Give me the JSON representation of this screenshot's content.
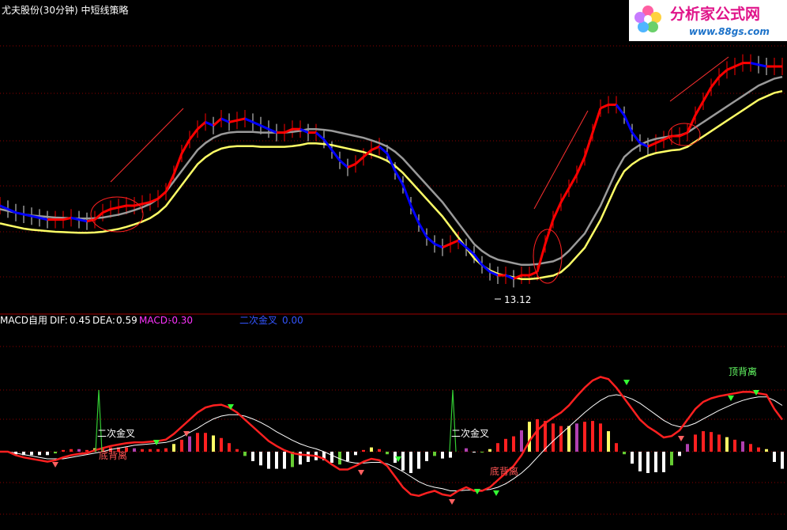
{
  "header": {
    "title": "尤夫股份(30分钟) 中短线策略"
  },
  "watermark": {
    "name": "分析家公式网",
    "url": "www.88gs.com"
  },
  "price_panel": {
    "low_label": "13.12"
  },
  "macd_panel": {
    "title": "MACD自用",
    "dif_label": "DIF:",
    "dif_value": "0.45",
    "dea_label": "DEA:",
    "dea_value": "0.59",
    "macd_label": "MACD:",
    "macd_value": "-0.30",
    "cross_label": "二次金叉",
    "cross_value": "0.00",
    "annotations": [
      "二次金叉",
      "底背离",
      "二次金叉",
      "底背离",
      "顶背离"
    ]
  },
  "colors": {
    "background": "#000000",
    "grid": "#8b0000",
    "up": "#ff0000",
    "down": "#0000ff",
    "ma_long": "#9a9a9a",
    "signal_line": "#ffff66",
    "macd_text": "#ff33ff",
    "cross_text": "#3355ff",
    "annotation": "#ffffff",
    "bottom_divergence": "#ff4444",
    "top_divergence": "#66ff66"
  },
  "chart_data": [
    {
      "type": "line",
      "name": "price",
      "x": [
        0,
        10,
        20,
        30,
        40,
        50,
        60,
        70,
        80,
        90,
        100,
        110,
        120,
        130,
        140,
        150,
        160,
        170,
        180,
        190,
        200,
        210,
        220,
        230,
        240,
        250,
        260,
        270,
        280,
        290,
        300,
        310,
        320,
        330,
        340,
        350,
        360,
        370,
        380,
        390,
        400,
        410,
        420,
        430,
        440,
        450,
        460,
        470,
        480,
        490,
        500,
        510,
        520,
        530,
        540,
        550,
        560,
        570,
        580,
        590,
        600,
        610,
        620,
        630,
        640,
        650,
        660,
        670,
        680,
        690,
        700,
        710,
        720,
        730,
        740,
        750,
        760,
        770,
        780,
        790,
        800,
        810,
        820,
        830,
        840,
        850,
        860,
        870,
        880,
        890,
        900,
        910,
        920,
        930,
        940,
        950,
        960,
        970,
        980,
        990
      ],
      "series": [
        {
          "name": "price",
          "values": [
            16.0,
            15.9,
            15.8,
            15.75,
            15.7,
            15.65,
            15.6,
            15.6,
            15.6,
            15.65,
            15.6,
            15.55,
            15.6,
            15.8,
            15.9,
            15.95,
            16.0,
            16.0,
            16.05,
            16.1,
            16.2,
            16.4,
            16.9,
            17.5,
            17.9,
            18.2,
            18.4,
            18.3,
            18.5,
            18.4,
            18.45,
            18.5,
            18.4,
            18.3,
            18.2,
            18.1,
            18.1,
            18.2,
            18.2,
            18.1,
            18.1,
            17.9,
            17.6,
            17.3,
            17.1,
            17.2,
            17.4,
            17.6,
            17.7,
            17.5,
            17.0,
            16.6,
            16.0,
            15.5,
            15.1,
            14.9,
            14.8,
            14.9,
            15.0,
            14.8,
            14.6,
            14.3,
            14.1,
            14.0,
            14.0,
            13.9,
            14.0,
            14.0,
            14.1,
            14.9,
            15.6,
            16.1,
            16.5,
            16.9,
            17.4,
            18.1,
            18.8,
            18.9,
            18.9,
            18.6,
            18.1,
            17.8,
            17.7,
            17.8,
            17.9,
            18.0,
            18.0,
            18.1,
            18.6,
            19.0,
            19.4,
            19.7,
            19.9,
            20.0,
            20.1,
            20.1,
            20.05,
            20.0,
            20.0,
            20.0
          ]
        },
        {
          "name": "long_ma",
          "values": [
            15.9,
            15.85,
            15.8,
            15.75,
            15.72,
            15.7,
            15.68,
            15.66,
            15.65,
            15.64,
            15.63,
            15.63,
            15.64,
            15.66,
            15.7,
            15.74,
            15.8,
            15.87,
            15.95,
            16.05,
            16.2,
            16.4,
            16.7,
            17.0,
            17.3,
            17.6,
            17.8,
            17.95,
            18.05,
            18.1,
            18.12,
            18.12,
            18.12,
            18.1,
            18.1,
            18.1,
            18.1,
            18.12,
            18.15,
            18.2,
            18.2,
            18.18,
            18.15,
            18.1,
            18.05,
            18.0,
            17.95,
            17.88,
            17.8,
            17.7,
            17.55,
            17.35,
            17.1,
            16.85,
            16.6,
            16.35,
            16.1,
            15.8,
            15.5,
            15.2,
            14.9,
            14.7,
            14.55,
            14.45,
            14.4,
            14.35,
            14.3,
            14.3,
            14.32,
            14.36,
            14.4,
            14.5,
            14.7,
            14.95,
            15.2,
            15.6,
            16.0,
            16.5,
            17.0,
            17.4,
            17.6,
            17.75,
            17.85,
            17.92,
            17.96,
            18.0,
            18.02,
            18.1,
            18.25,
            18.4,
            18.55,
            18.7,
            18.85,
            19.0,
            19.15,
            19.3,
            19.45,
            19.55,
            19.65,
            19.7
          ]
        }
      ],
      "low_marker": 13.12
    },
    {
      "type": "line",
      "name": "MACD",
      "x": [
        0,
        10,
        20,
        30,
        40,
        50,
        60,
        70,
        80,
        90,
        100,
        110,
        120,
        130,
        140,
        150,
        160,
        170,
        180,
        190,
        200,
        210,
        220,
        230,
        240,
        250,
        260,
        270,
        280,
        290,
        300,
        310,
        320,
        330,
        340,
        350,
        360,
        370,
        380,
        390,
        400,
        410,
        420,
        430,
        440,
        450,
        460,
        470,
        480,
        490,
        500,
        510,
        520,
        530,
        540,
        550,
        560,
        570,
        580,
        590,
        600,
        610,
        620,
        630,
        640,
        650,
        660,
        670,
        680,
        690,
        700,
        710,
        720,
        730,
        740,
        750,
        760,
        770,
        780,
        790,
        800,
        810,
        820,
        830,
        840,
        850,
        860,
        870,
        880,
        890,
        900,
        910,
        920,
        930,
        940,
        950,
        960,
        970,
        980,
        990
      ],
      "series": [
        {
          "name": "DIF",
          "values": [
            0.0,
            0.0,
            -0.05,
            -0.08,
            -0.1,
            -0.12,
            -0.14,
            -0.12,
            -0.08,
            -0.05,
            -0.03,
            -0.02,
            0.02,
            0.05,
            0.08,
            0.1,
            0.12,
            0.13,
            0.13,
            0.14,
            0.15,
            0.17,
            0.25,
            0.35,
            0.45,
            0.55,
            0.62,
            0.65,
            0.66,
            0.62,
            0.55,
            0.45,
            0.35,
            0.25,
            0.15,
            0.08,
            0.02,
            -0.02,
            -0.04,
            -0.05,
            -0.06,
            -0.1,
            -0.18,
            -0.25,
            -0.25,
            -0.2,
            -0.14,
            -0.1,
            -0.12,
            -0.2,
            -0.35,
            -0.5,
            -0.6,
            -0.62,
            -0.58,
            -0.55,
            -0.6,
            -0.62,
            -0.55,
            -0.5,
            -0.55,
            -0.55,
            -0.5,
            -0.4,
            -0.3,
            -0.2,
            -0.05,
            0.15,
            0.3,
            0.4,
            0.48,
            0.55,
            0.65,
            0.78,
            0.9,
            1.0,
            1.05,
            1.02,
            0.9,
            0.75,
            0.6,
            0.45,
            0.35,
            0.28,
            0.2,
            0.22,
            0.3,
            0.45,
            0.6,
            0.7,
            0.75,
            0.78,
            0.8,
            0.82,
            0.84,
            0.84,
            0.82,
            0.8,
            0.6,
            0.45
          ]
        },
        {
          "name": "DEA",
          "values": [
            0.0,
            0.0,
            -0.02,
            -0.04,
            -0.06,
            -0.08,
            -0.1,
            -0.1,
            -0.1,
            -0.08,
            -0.06,
            -0.04,
            -0.02,
            0.0,
            0.03,
            0.05,
            0.07,
            0.09,
            0.1,
            0.11,
            0.12,
            0.13,
            0.16,
            0.21,
            0.27,
            0.33,
            0.4,
            0.46,
            0.5,
            0.52,
            0.52,
            0.5,
            0.46,
            0.41,
            0.35,
            0.28,
            0.22,
            0.16,
            0.11,
            0.07,
            0.04,
            0.0,
            -0.05,
            -0.1,
            -0.14,
            -0.16,
            -0.16,
            -0.15,
            -0.15,
            -0.17,
            -0.22,
            -0.28,
            -0.35,
            -0.42,
            -0.47,
            -0.5,
            -0.52,
            -0.55,
            -0.55,
            -0.54,
            -0.54,
            -0.54,
            -0.53,
            -0.5,
            -0.45,
            -0.38,
            -0.3,
            -0.2,
            -0.08,
            0.04,
            0.15,
            0.25,
            0.35,
            0.45,
            0.55,
            0.64,
            0.72,
            0.78,
            0.8,
            0.78,
            0.74,
            0.68,
            0.6,
            0.52,
            0.44,
            0.38,
            0.35,
            0.36,
            0.4,
            0.46,
            0.52,
            0.58,
            0.63,
            0.68,
            0.72,
            0.75,
            0.77,
            0.77,
            0.72,
            0.65
          ]
        },
        {
          "name": "MACD",
          "values": [
            0.0,
            0.0,
            -0.06,
            -0.08,
            -0.08,
            -0.08,
            -0.08,
            -0.04,
            0.04,
            0.06,
            0.06,
            0.04,
            0.08,
            0.1,
            0.1,
            0.1,
            0.1,
            0.08,
            0.06,
            0.06,
            0.06,
            0.08,
            0.18,
            0.28,
            0.36,
            0.44,
            0.44,
            0.38,
            0.32,
            0.2,
            0.06,
            -0.1,
            -0.22,
            -0.32,
            -0.4,
            -0.4,
            -0.4,
            -0.36,
            -0.3,
            -0.24,
            -0.2,
            -0.2,
            -0.26,
            -0.3,
            -0.22,
            -0.08,
            0.04,
            0.1,
            0.06,
            -0.06,
            -0.26,
            -0.44,
            -0.5,
            -0.4,
            -0.22,
            -0.1,
            -0.16,
            -0.14,
            0.0,
            0.08,
            -0.02,
            -0.02,
            0.06,
            0.2,
            0.3,
            0.36,
            0.5,
            0.7,
            0.76,
            0.72,
            0.66,
            0.6,
            0.6,
            0.66,
            0.7,
            0.72,
            0.66,
            0.48,
            0.2,
            -0.06,
            -0.28,
            -0.46,
            -0.5,
            -0.48,
            -0.48,
            -0.32,
            -0.1,
            0.18,
            0.4,
            0.48,
            0.46,
            0.4,
            0.34,
            0.28,
            0.24,
            0.18,
            0.1,
            0.06,
            -0.24,
            -0.4
          ]
        }
      ]
    }
  ]
}
